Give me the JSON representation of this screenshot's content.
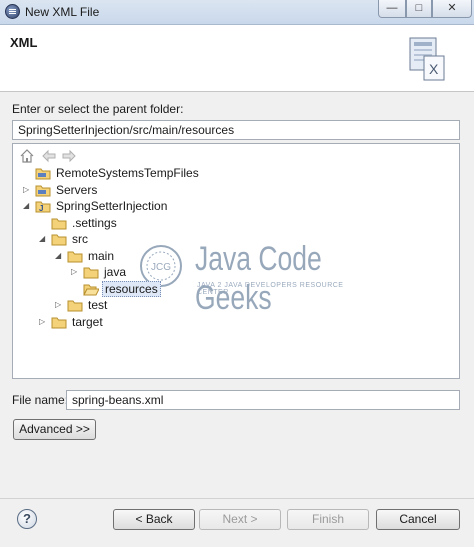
{
  "window": {
    "title": "New XML File",
    "min_glyph": "—",
    "max_glyph": "□",
    "close_glyph": "✕"
  },
  "header": {
    "title": "XML",
    "icon": "xml-file-icon"
  },
  "parent_folder": {
    "prompt": "Enter or select the parent folder:",
    "value": "SpringSetterInjection/src/main/resources"
  },
  "tree": {
    "toolbar": [
      "home-icon",
      "back-arrow-icon",
      "forward-arrow-icon"
    ],
    "items": [
      {
        "label": "RemoteSystemsTempFiles",
        "expander": "",
        "icon": "project-folder-icon"
      },
      {
        "label": "Servers",
        "expander": "▷",
        "icon": "project-folder-icon"
      },
      {
        "label": "SpringSetterInjection",
        "expander": "◢",
        "icon": "java-project-icon"
      },
      {
        "label": ".settings",
        "expander": "",
        "icon": "folder-icon"
      },
      {
        "label": "src",
        "expander": "◢",
        "icon": "folder-icon"
      },
      {
        "label": "main",
        "expander": "◢",
        "icon": "folder-icon"
      },
      {
        "label": "java",
        "expander": "▷",
        "icon": "folder-icon"
      },
      {
        "label": "resources",
        "expander": "",
        "icon": "open-folder-icon",
        "selected": true
      },
      {
        "label": "test",
        "expander": "▷",
        "icon": "folder-icon"
      },
      {
        "label": "target",
        "expander": "▷",
        "icon": "folder-icon"
      }
    ]
  },
  "watermark": {
    "main": "Java Code Geeks",
    "sub": "JAVA 2 JAVA DEVELOPERS RESOURCE CENTER",
    "logo": "JCG"
  },
  "file_name": {
    "label": "File name:",
    "value": "spring-beans.xml"
  },
  "buttons": {
    "advanced": "Advanced >>",
    "help": "?",
    "back": "< Back",
    "next": "Next >",
    "finish": "Finish",
    "cancel": "Cancel"
  }
}
